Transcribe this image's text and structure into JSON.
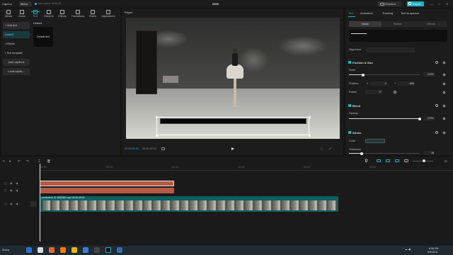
{
  "app": {
    "logo": "CapCut",
    "menu_label": "Menu",
    "autosave": "Auto saved: 18:50:46",
    "project_title": "0509",
    "shortcut_label": "Shortcut",
    "export_label": "Export",
    "accent": "#17b2c2"
  },
  "left": {
    "tabs": [
      "Media",
      "Audio",
      "Text",
      "Stickers",
      "Effects",
      "Transitions",
      "Filters",
      "Adjustment"
    ],
    "active_tab": "Text",
    "nav": [
      "+ Add text",
      "Default",
      "• Effects",
      "• Text template",
      "Auto captions",
      "Local captio..."
    ],
    "section_title": "Default",
    "card_label": "Default text"
  },
  "player": {
    "title": "Player",
    "current_time": "00:00:00:00",
    "total_time": "00:00:45:02"
  },
  "right": {
    "tabs": [
      "Text",
      "Animation",
      "Tracking",
      "Text-to-speech"
    ],
    "segments": [
      "Basic",
      "Bubble",
      "Effects"
    ],
    "alignment_label": "Alignment",
    "position_size": "Position & Size",
    "scale_label": "Scale",
    "scale_value": "100%",
    "scale_fraction": 0.2,
    "position_label": "Position",
    "pos_x_label": "X",
    "pos_x": "0",
    "pos_y_label": "Y",
    "pos_y": "-856",
    "rotate_label": "Rotate",
    "rotate_value": "0°",
    "blend_label": "Blend",
    "opacity_label": "Opacity",
    "opacity_value": "100%",
    "opacity_fraction": 1.0,
    "stroke_label": "Stroke",
    "color_label": "Color",
    "thickness_label": "Thickness",
    "thickness_value": "18",
    "thickness_fraction": 0.18
  },
  "timeline": {
    "ruler": [
      "00:00",
      "|00:10",
      "|00:20",
      "|00:30",
      "|00:40",
      "|00:50"
    ],
    "text_clip_1": "",
    "text_clip_2": "",
    "video_clip": "production ID 4990382.mp4   00:00:45:02",
    "cover_label": "Cover"
  },
  "taskbar": {
    "weather": "Sunny",
    "time": "6:56 PM",
    "date": "5/9/2023"
  }
}
